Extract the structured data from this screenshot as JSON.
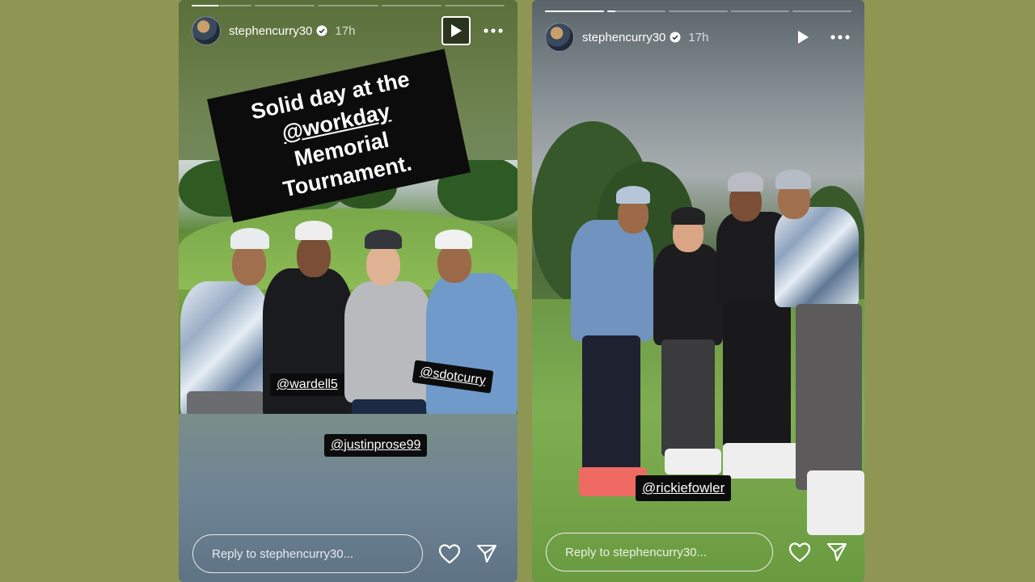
{
  "stories": [
    {
      "username": "stephencurry30",
      "time": "17h",
      "progress_fraction": 0.45,
      "segments": 5,
      "caption": {
        "line1_prefix": "Solid day at the ",
        "line1_mention": "@workday",
        "line2": "Memorial Tournament."
      },
      "tags": {
        "wardell": "@wardell5",
        "sdot": "@sdotcurry",
        "justin": "@justinprose99"
      },
      "reply_placeholder": "Reply to stephencurry30..."
    },
    {
      "username": "stephencurry30",
      "time": "17h",
      "progress_fraction": 0.0,
      "segments": 5,
      "tags": {
        "rickie": "@rickiefowler"
      },
      "reply_placeholder": "Reply to stephencurry30..."
    }
  ],
  "icons": {
    "verified": "verified-badge-icon",
    "play": "play-icon",
    "more": "more-icon",
    "heart": "heart-icon",
    "send": "send-icon"
  },
  "colors": {
    "background": "#8f9654",
    "tag_background": "#0c0c0c",
    "text": "#ffffff"
  }
}
